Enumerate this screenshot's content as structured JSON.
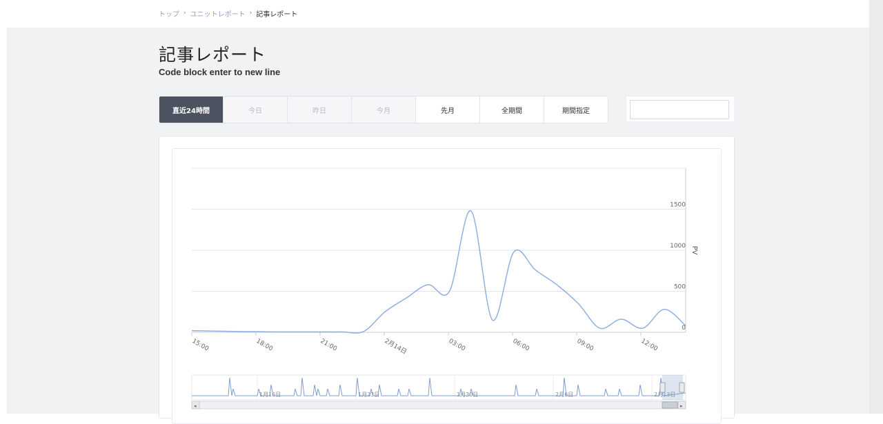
{
  "breadcrumb": {
    "items": [
      "トップ",
      "ユニットレポート"
    ],
    "separator": "›",
    "current": "記事レポート"
  },
  "page": {
    "title": "記事レポート",
    "subtitle": "Code block enter to new line"
  },
  "period_buttons": [
    {
      "label": "直近24時間",
      "state": "active"
    },
    {
      "label": "今日",
      "state": "disabled"
    },
    {
      "label": "昨日",
      "state": "disabled"
    },
    {
      "label": "今月",
      "state": "disabled"
    },
    {
      "label": "先月",
      "state": "normal"
    },
    {
      "label": "全期間",
      "state": "normal"
    },
    {
      "label": "期間指定",
      "state": "normal"
    }
  ],
  "date_input": {
    "value": "",
    "placeholder": ""
  },
  "colors": {
    "active_button": "#4d5260",
    "series_line": "#8fb0e0",
    "grid": "#e6e8ec"
  },
  "chart_data": {
    "type": "line",
    "ylabel": "PV",
    "ylim": [
      0,
      2000
    ],
    "y_ticks": [
      0,
      500,
      1000,
      1500
    ],
    "x_tick_labels": [
      "15:00",
      "18:00",
      "21:00",
      "2月14日",
      "03:00",
      "06:00",
      "09:00",
      "12:00"
    ],
    "series": [
      {
        "x": [
          0,
          1,
          2,
          3,
          4,
          5,
          6,
          7,
          8,
          9,
          10,
          11,
          12,
          13,
          14,
          15,
          16,
          17,
          18,
          19,
          20,
          21,
          22,
          23
        ],
        "values": [
          20,
          15,
          10,
          8,
          5,
          5,
          5,
          5,
          10,
          250,
          420,
          580,
          500,
          1480,
          150,
          980,
          760,
          580,
          350,
          50,
          160,
          50,
          280,
          80
        ]
      }
    ],
    "navigator": {
      "tick_labels": [
        "1月16日",
        "1月23日",
        "1月30日",
        "2月6日",
        "2月13日"
      ]
    }
  }
}
